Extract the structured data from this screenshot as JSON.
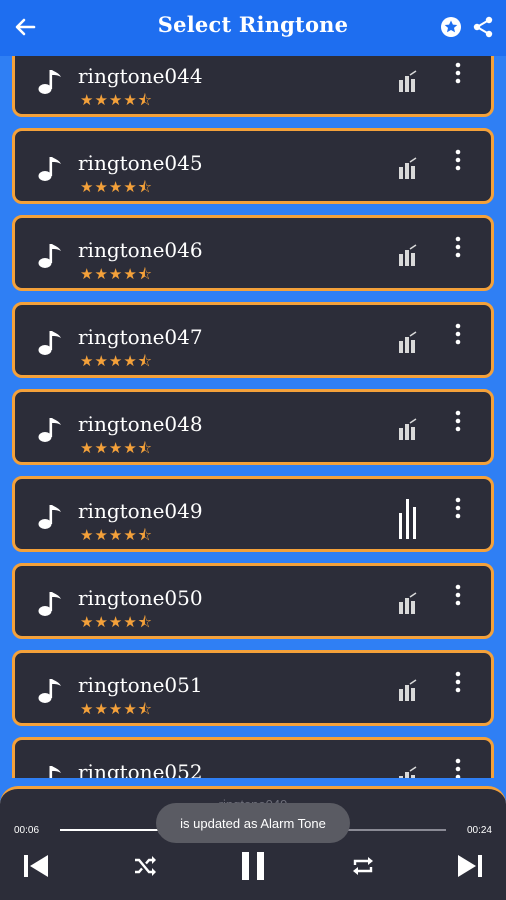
{
  "app": {
    "title": "Select Ringtone",
    "accent_color": "#f4a13a",
    "topbar_color": "#1e6ef0",
    "background_color": "#2f7ff4",
    "card_color": "#2c2d39"
  },
  "header": {
    "back_icon": "arrow-left-icon",
    "actions": [
      "star-badge-icon",
      "share-icon"
    ]
  },
  "ringtones": [
    {
      "name": "ringtone044",
      "rating": "★★★★⯪",
      "playing": false
    },
    {
      "name": "ringtone045",
      "rating": "★★★★⯪",
      "playing": false
    },
    {
      "name": "ringtone046",
      "rating": "★★★★⯪",
      "playing": false
    },
    {
      "name": "ringtone047",
      "rating": "★★★★⯪",
      "playing": false
    },
    {
      "name": "ringtone048",
      "rating": "★★★★⯪",
      "playing": false
    },
    {
      "name": "ringtone049",
      "rating": "★★★★⯪",
      "playing": true
    },
    {
      "name": "ringtone050",
      "rating": "★★★★⯪",
      "playing": false
    },
    {
      "name": "ringtone051",
      "rating": "★★★★⯪",
      "playing": false
    },
    {
      "name": "ringtone052",
      "rating": "★★★★⯪",
      "playing": false
    }
  ],
  "player": {
    "now_playing": "ringtone049",
    "time_elapsed": "00:06",
    "time_total": "00:24",
    "progress": 0.27,
    "controls": [
      "skip-previous-icon",
      "shuffle-icon",
      "pause-icon",
      "repeat-icon",
      "skip-next-icon"
    ]
  },
  "toast": {
    "message": "is updated as Alarm Tone"
  }
}
